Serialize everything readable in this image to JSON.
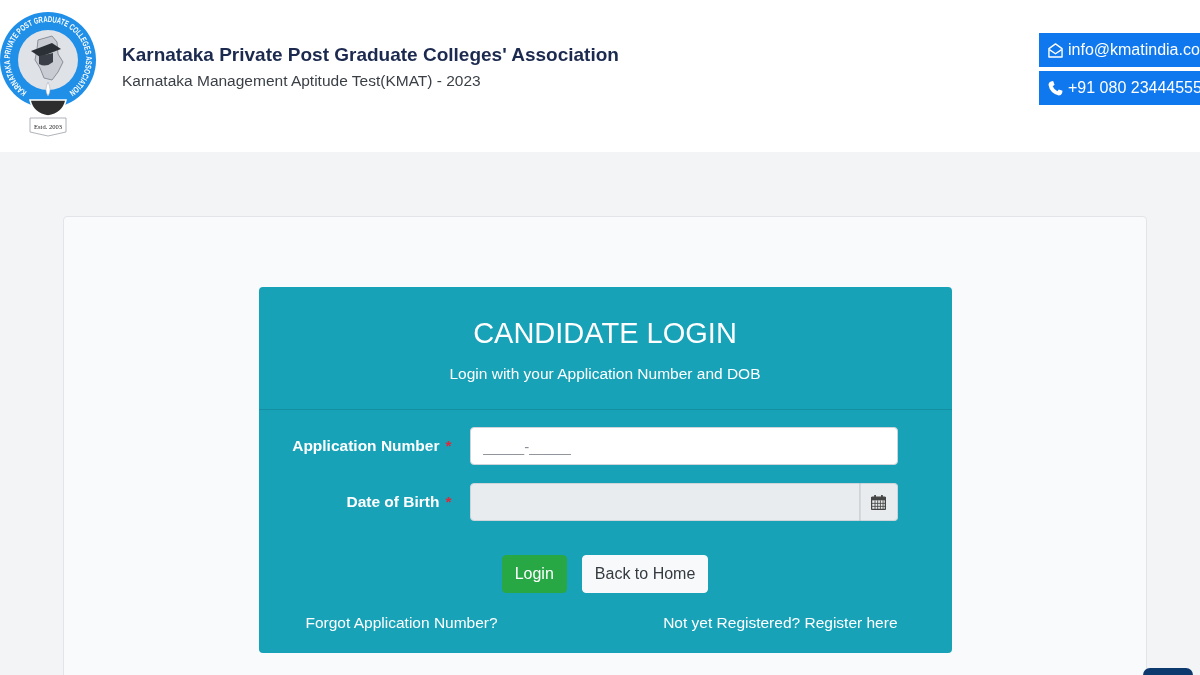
{
  "header": {
    "logo": {
      "ring_text": "KARNATAKA PRIVATE POST GRADUATE COLLEGES ASSOCIATION",
      "banner": "Estd. 2003"
    },
    "title": "Karnataka Private Post Graduate Colleges' Association",
    "subtitle": "Karnataka Management Aptitude Test(KMAT) - 2023",
    "contacts": [
      {
        "kind": "email",
        "text": "info@kmatindia.co"
      },
      {
        "kind": "phone",
        "text": "+91 080 23444555"
      }
    ]
  },
  "login": {
    "title": "CANDIDATE LOGIN",
    "subtitle": "Login with your Application Number and DOB",
    "fields": [
      {
        "kind": "text",
        "label": "Application Number",
        "required_mark": "*",
        "placeholder": "_____-_____",
        "readonly": false
      },
      {
        "kind": "date",
        "label": "Date of Birth",
        "required_mark": "*",
        "readonly": true
      }
    ],
    "buttons": [
      {
        "kind": "primary",
        "label": "Login"
      },
      {
        "kind": "secondary",
        "label": "Back to Home"
      }
    ],
    "links": [
      "Forgot Application Number?",
      "Not yet Registered? Register here"
    ]
  }
}
